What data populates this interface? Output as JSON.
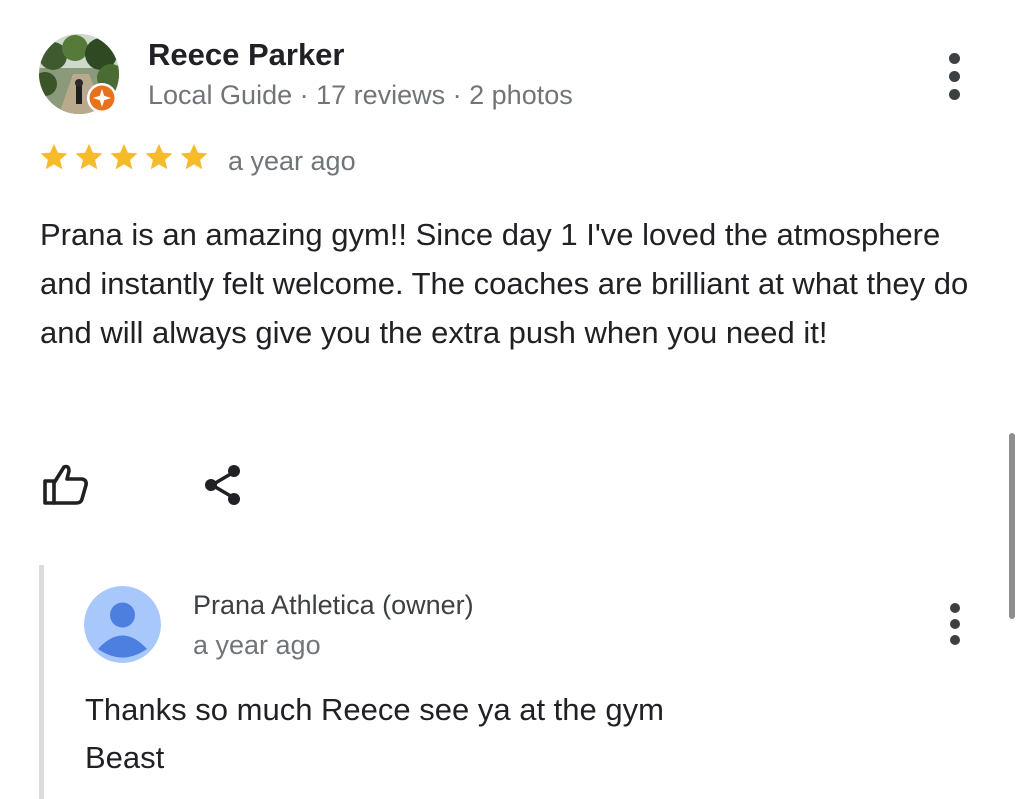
{
  "review": {
    "reviewer_name": "Reece Parker",
    "reviewer_meta": "Local Guide · 17 reviews · 2 photos",
    "rating": 5,
    "time": "a year ago",
    "text": "Prana is an amazing gym!! Since day 1 I've loved the atmosphere and instantly felt welcome. The coaches are brilliant at what they do and will always give you the extra push when you need it!"
  },
  "owner_reply": {
    "name": "Prana Athletica (owner)",
    "time": "a year ago",
    "lines": [
      "Thanks so much Reece see ya at the gym",
      "Beast"
    ]
  },
  "icons": {
    "more": "more-vert-icon",
    "like": "thumb-up-icon",
    "share": "share-icon",
    "star": "star-icon",
    "badge": "local-guide-badge-icon"
  },
  "colors": {
    "star": "#f6bb2b",
    "badge": "#e8711c",
    "owner_avatar_bg": "#a8c7fa",
    "owner_avatar_fg": "#4c7fe0",
    "meta_text": "#70757a"
  }
}
